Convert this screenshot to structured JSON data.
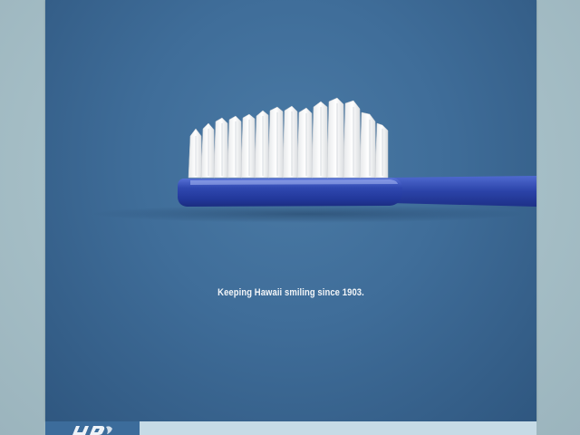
{
  "ad": {
    "tagline": "Keeping Hawaii smiling since 1903."
  },
  "colors": {
    "poster_background": "#3f6d99",
    "brush_handle": "#2f48b0",
    "bristles": "#f4f4f2",
    "footer_bar": "#c6dbe6",
    "logo_block": "#3c6c9b"
  },
  "icons": {
    "logo": "company-logo-icon"
  }
}
